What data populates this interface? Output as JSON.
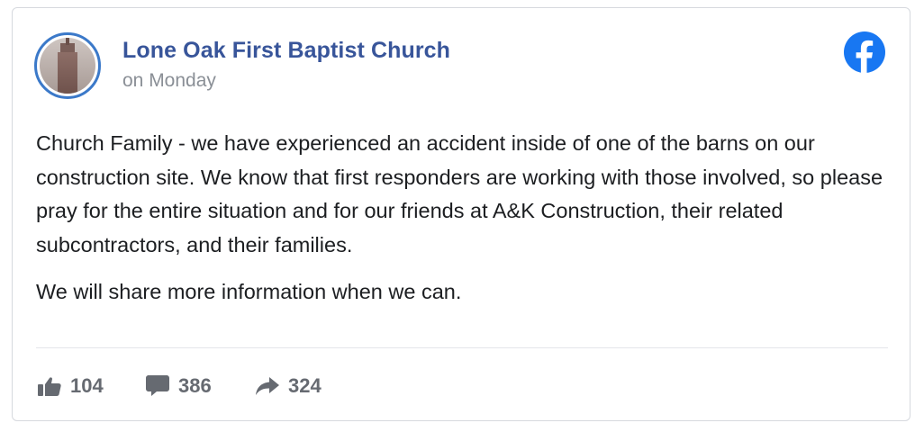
{
  "post": {
    "page_name": "Lone Oak First Baptist Church",
    "timestamp": "on Monday",
    "avatar_icon": "church-tower-avatar",
    "platform_icon": "facebook-icon",
    "brand_color": "#1877f2",
    "paragraphs": [
      "Church Family - we have experienced an accident inside of one of the barns on our construction site. We know that first responders are working with those involved, so please pray for the entire situation and for our friends at A&K Construction, their related subcontractors, and their families.",
      "We will share more information when we can."
    ]
  },
  "stats": {
    "likes": "104",
    "comments": "386",
    "shares": "324",
    "like_icon": "thumbs-up-icon",
    "comment_icon": "comment-icon",
    "share_icon": "share-arrow-icon"
  }
}
